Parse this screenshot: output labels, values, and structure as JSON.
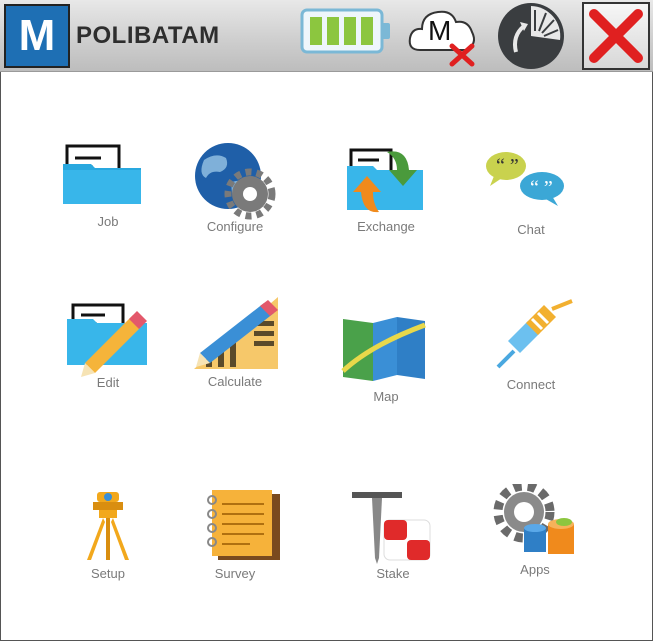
{
  "header": {
    "logo_letter": "M",
    "title": "POLIBATAM",
    "cloud_letter": "M",
    "icons": {
      "battery": "battery-full-icon",
      "cloud": "cloud-disconnected-icon",
      "clock": "clock-history-icon",
      "close": "close-icon"
    },
    "battery_level": 1.0
  },
  "menu": {
    "items": [
      {
        "label": "Job",
        "icon": "folder-document-icon"
      },
      {
        "label": "Configure",
        "icon": "globe-gear-icon"
      },
      {
        "label": "Exchange",
        "icon": "folder-exchange-icon"
      },
      {
        "label": "Chat",
        "icon": "chat-bubbles-icon"
      },
      {
        "label": "Edit",
        "icon": "folder-pencil-icon"
      },
      {
        "label": "Calculate",
        "icon": "pencil-chart-icon"
      },
      {
        "label": "Map",
        "icon": "map-icon"
      },
      {
        "label": "Connect",
        "icon": "plug-connector-icon"
      },
      {
        "label": "Setup",
        "icon": "tripod-instrument-icon"
      },
      {
        "label": "Survey",
        "icon": "notebook-icon"
      },
      {
        "label": "Stake",
        "icon": "stake-target-icon"
      },
      {
        "label": "Apps",
        "icon": "gear-database-icon"
      }
    ]
  },
  "colors": {
    "header_bg": "#cfcfcf",
    "logo_blue": "#1e6fb4",
    "battery_green": "#8cc63f",
    "close_red": "#e02020",
    "label_gray": "#7a7a7a"
  }
}
